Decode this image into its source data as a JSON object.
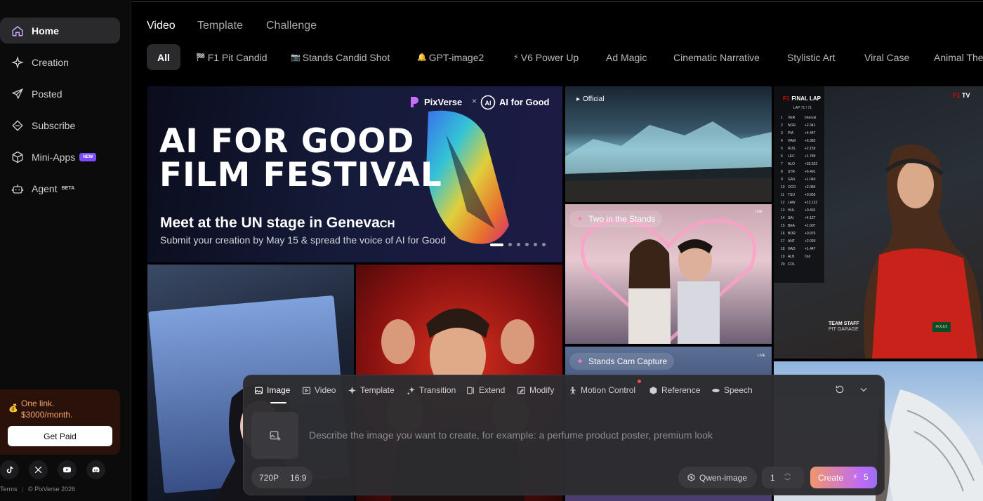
{
  "sidebar": {
    "items": [
      {
        "label": "Home",
        "icon": "home-icon"
      },
      {
        "label": "Creation",
        "icon": "sparkle-icon"
      },
      {
        "label": "Posted",
        "icon": "send-icon"
      },
      {
        "label": "Subscribe",
        "icon": "diamond-icon"
      },
      {
        "label": "Mini-Apps",
        "icon": "cube-icon",
        "badge": "NEW"
      },
      {
        "label": "Agent",
        "icon": "robot-icon",
        "badge": "BETA"
      }
    ],
    "promo": {
      "line1": "One link.",
      "line2": "$3000/month.",
      "button": "Get Paid"
    },
    "social": [
      "tiktok-icon",
      "x-icon",
      "youtube-icon",
      "discord-icon"
    ],
    "footer": {
      "terms": "Terms",
      "sep": "|",
      "copyright": "© PixVerse 2026"
    }
  },
  "tabs": [
    "Video",
    "Template",
    "Challenge"
  ],
  "chips": [
    {
      "label": "All",
      "icon": ""
    },
    {
      "label": "F1 Pit Candid",
      "icon": "🏁"
    },
    {
      "label": "Stands Candid Shot",
      "icon": "📷"
    },
    {
      "label": "GPT-image2",
      "icon": "🔔"
    },
    {
      "label": "V6 Power Up",
      "icon": "⚡"
    },
    {
      "label": "Ad Magic",
      "icon": ""
    },
    {
      "label": "Cinematic Narrative",
      "icon": ""
    },
    {
      "label": "Stylistic Art",
      "icon": ""
    },
    {
      "label": "Viral Case",
      "icon": ""
    },
    {
      "label": "Animal The",
      "icon": ""
    }
  ],
  "banner": {
    "logo": "PixVerse",
    "times": "×",
    "partner": "AI for Good",
    "title1": "AI FOR GOOD",
    "title2": "FILM FESTIVAL",
    "headline": "Meet at the UN stage in Geneva",
    "headline_tag": "CH",
    "subline": "Submit your creation by May 15 & spread the voice of AI for Good",
    "slide_index": 1,
    "slide_count": 6
  },
  "tiles": {
    "official": "Official",
    "two_stands": "Two in the Stands",
    "stands_cam": "Stands Cam Capture",
    "live": "LIVE",
    "f1_header": "FINAL LAP",
    "f1_lap": "LAP 71 / 71",
    "f1_tv": "TV",
    "team_staff": "TEAM STAFF",
    "pit_garage": "PIT GARAGE",
    "rolex": "ROLEX",
    "drivers": [
      "VER",
      "NOR",
      "PIA",
      "HAM",
      "RUS",
      "LEC",
      "ALO",
      "STR",
      "GAS",
      "OCO",
      "TSU",
      "LAW",
      "HUL",
      "SAI",
      "BEA",
      "BOR",
      "ANT",
      "HAD",
      "ALB",
      "COL"
    ],
    "gaps": [
      "Interval",
      "+2.341",
      "+4.447",
      "+6.382",
      "+2.159",
      "+1.789",
      "+32.522",
      "+6.491",
      "+1.040",
      "+2.084",
      "+0.955",
      "+12.122",
      "+0.401",
      "+4.127",
      "+1.007",
      "+0.976",
      "+2.020",
      "+1.447",
      "Out",
      ""
    ]
  },
  "composer": {
    "modes": [
      {
        "label": "Image",
        "icon": "image-icon"
      },
      {
        "label": "Video",
        "icon": "video-icon"
      },
      {
        "label": "Template",
        "icon": "template-icon"
      },
      {
        "label": "Transition",
        "icon": "transition-icon"
      },
      {
        "label": "Extend",
        "icon": "extend-icon"
      },
      {
        "label": "Modify",
        "icon": "modify-icon"
      },
      {
        "label": "Motion Control",
        "icon": "motion-icon"
      },
      {
        "label": "Reference",
        "icon": "reference-icon"
      },
      {
        "label": "Speech",
        "icon": "speech-icon"
      }
    ],
    "placeholder": "Describe the image you want to create, for example: a perfume product poster, premium look",
    "resolution": "720P",
    "ratio": "16:9",
    "model": "Qwen-image",
    "count": "1",
    "create": "Create",
    "cost": "5",
    "colors": {
      "accent_start": "#f0956c",
      "accent_end": "#9a6ef5"
    }
  }
}
